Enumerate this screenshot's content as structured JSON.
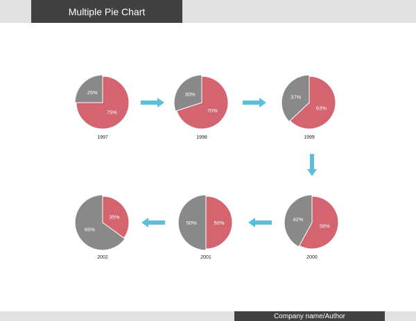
{
  "header": {
    "title": "Multiple Pie Chart"
  },
  "footer": {
    "text": "Company name/Author"
  },
  "colors": {
    "gray_slice": "#898989",
    "red_slice": "#d36470",
    "arrow": "#5bbfdb",
    "band": "#e1e1e1",
    "title_box": "#414141"
  },
  "chart_data": {
    "type": "pie",
    "title": "Multiple Pie Chart",
    "series_colors": [
      "#898989",
      "#d36470"
    ],
    "pies": [
      {
        "year": "1997",
        "values": [
          25,
          75
        ],
        "labels": [
          "25%",
          "75%"
        ]
      },
      {
        "year": "1998",
        "values": [
          30,
          70
        ],
        "labels": [
          "30%",
          "70%"
        ]
      },
      {
        "year": "1999",
        "values": [
          37,
          63
        ],
        "labels": [
          "37%",
          "63%"
        ]
      },
      {
        "year": "2000",
        "values": [
          42,
          58
        ],
        "labels": [
          "42%",
          "58%"
        ]
      },
      {
        "year": "2001",
        "values": [
          50,
          50
        ],
        "labels": [
          "50%",
          "50%"
        ]
      },
      {
        "year": "2002",
        "values": [
          65,
          35
        ],
        "labels": [
          "65%",
          "35%"
        ]
      }
    ],
    "flow": [
      "right",
      "right",
      "down",
      "left",
      "left"
    ]
  }
}
